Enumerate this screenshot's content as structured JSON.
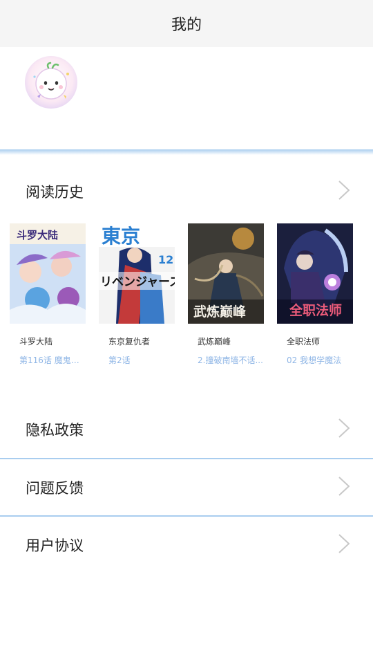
{
  "header": {
    "title": "我的"
  },
  "history": {
    "label": "阅读历史",
    "items": [
      {
        "title": "斗罗大陆",
        "chapter": "第116话 魔鬼遗..."
      },
      {
        "title": "东京复仇者",
        "chapter": "第2话"
      },
      {
        "title": "武炼巅峰",
        "chapter": "2.撞破南墙不话..."
      },
      {
        "title": "全职法师",
        "chapter": "02 我想学魔法"
      }
    ]
  },
  "menu": [
    {
      "label": "隐私政策"
    },
    {
      "label": "问题反馈"
    },
    {
      "label": "用户协议"
    }
  ],
  "icons": {
    "avatar": "avatar-image",
    "chevron": "chevron-right-icon"
  },
  "colors": {
    "accent": "#a9cdef",
    "chapter": "#8fb6e6",
    "header_bg": "#f5f5f5"
  }
}
